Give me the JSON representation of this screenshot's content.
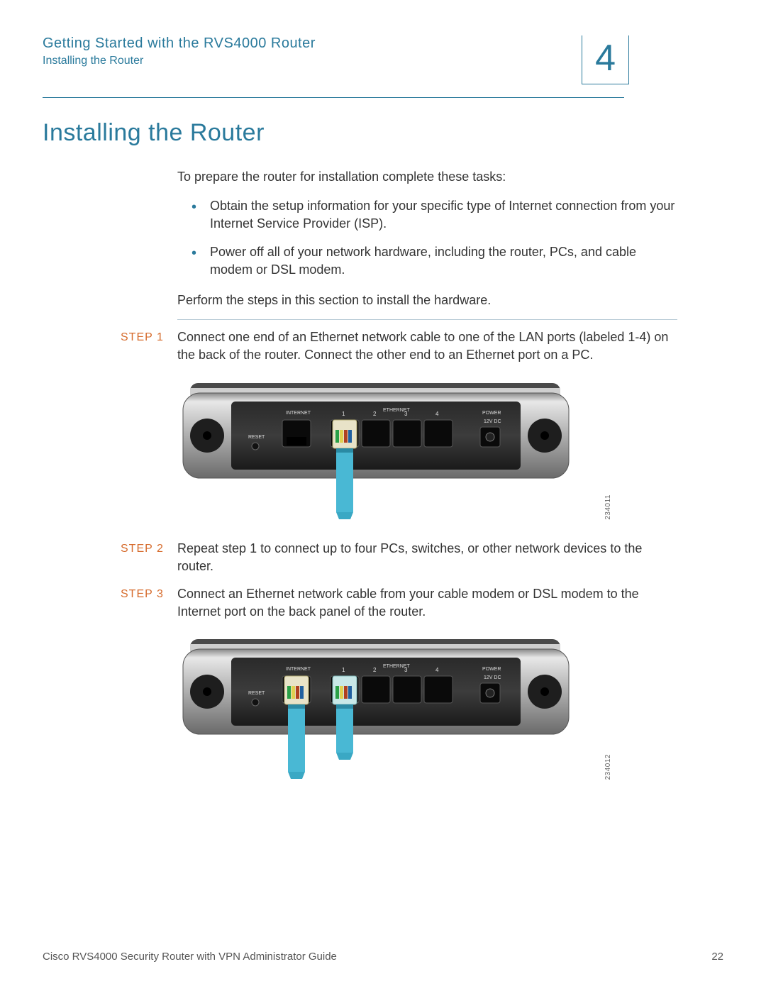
{
  "header": {
    "chapter_title": "Getting Started with the RVS4000 Router",
    "breadcrumb": "Installing the Router",
    "chapter_number": "4"
  },
  "section": {
    "title": "Installing the Router",
    "intro": "To prepare the router for installation complete these tasks:",
    "tasks": [
      "Obtain the setup information for your specific type of Internet connection from your Internet Service Provider (ISP).",
      "Power off all of your network hardware, including the router, PCs, and cable modem or DSL modem."
    ],
    "perform": "Perform the steps in this section to install the hardware."
  },
  "steps": [
    {
      "label": "STEP 1",
      "text": "Connect one end of an Ethernet network cable to one of the LAN ports (labeled 1-4) on the back of the router. Connect the other end to an Ethernet port on a PC."
    },
    {
      "label": "STEP 2",
      "text": "Repeat step 1 to connect up to four PCs, switches, or other network devices to the router."
    },
    {
      "label": "STEP 3",
      "text": "Connect an Ethernet network cable from your cable modem or DSL modem to the Internet port on the back panel of the router."
    }
  ],
  "figures": [
    {
      "id": "234011",
      "labels": {
        "reset": "RESET",
        "internet": "INTERNET",
        "ethernet": "ETHERNET",
        "power": "POWER",
        "voltage": "12V DC",
        "ports": [
          "1",
          "2",
          "3",
          "4"
        ]
      }
    },
    {
      "id": "234012",
      "labels": {
        "reset": "RESET",
        "internet": "INTERNET",
        "ethernet": "ETHERNET",
        "power": "POWER",
        "voltage": "12V DC",
        "ports": [
          "1",
          "2",
          "3",
          "4"
        ]
      }
    }
  ],
  "footer": {
    "guide": "Cisco RVS4000 Security Router with VPN Administrator Guide",
    "page": "22"
  }
}
